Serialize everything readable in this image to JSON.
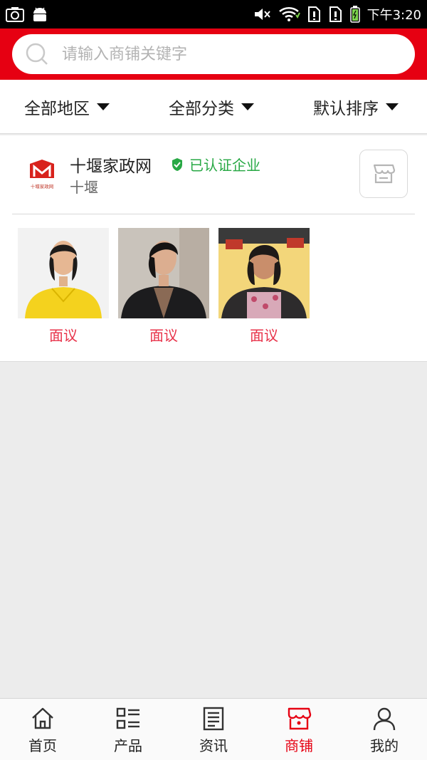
{
  "status_bar": {
    "time": "下午3:20",
    "icons": [
      "camera-icon",
      "android-icon",
      "mute-icon",
      "wifi-icon",
      "sim1-icon",
      "sim2-icon",
      "battery-icon"
    ]
  },
  "search": {
    "placeholder": "请输入商铺关键字",
    "value": ""
  },
  "filters": [
    {
      "label": "全部地区"
    },
    {
      "label": "全部分类"
    },
    {
      "label": "默认排序"
    }
  ],
  "shop": {
    "name": "十堰家政网",
    "verified_label": "已认证企业",
    "region": "十堰",
    "logo_text": "十堰家政网",
    "products": [
      {
        "price": "面议"
      },
      {
        "price": "面议"
      },
      {
        "price": "面议"
      }
    ]
  },
  "bottom_nav": {
    "items": [
      {
        "label": "首页",
        "icon": "home-icon"
      },
      {
        "label": "产品",
        "icon": "list-icon"
      },
      {
        "label": "资讯",
        "icon": "news-icon"
      },
      {
        "label": "商铺",
        "icon": "store-icon",
        "active": true
      },
      {
        "label": "我的",
        "icon": "user-icon"
      }
    ]
  },
  "colors": {
    "brand": "#e60012",
    "verified": "#27a844",
    "price": "#e8334a",
    "background": "#ececec"
  }
}
